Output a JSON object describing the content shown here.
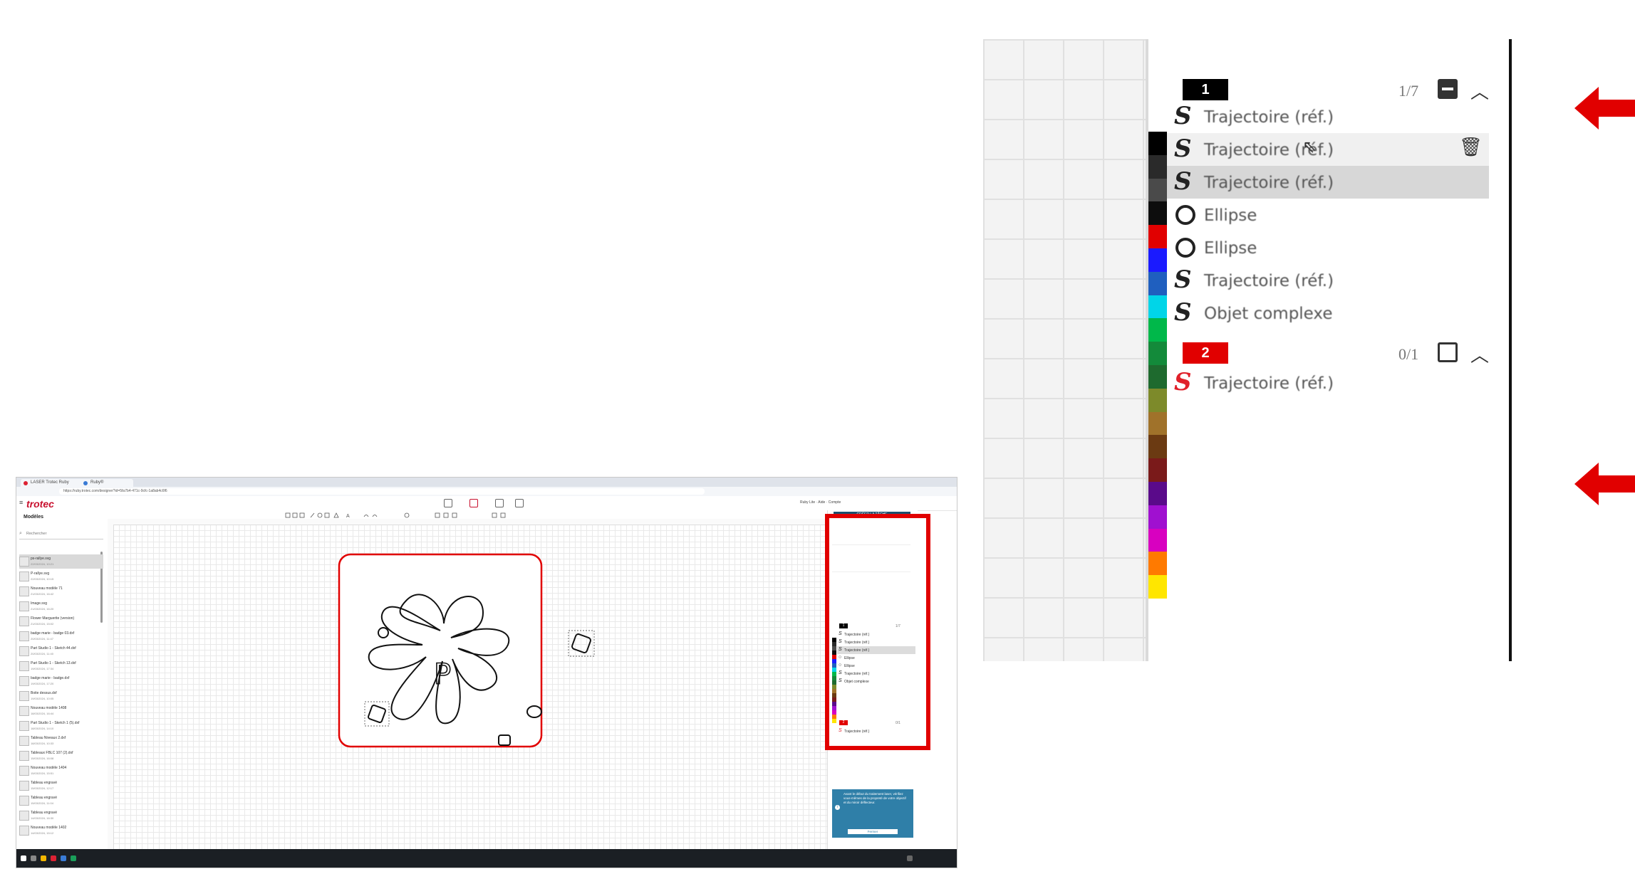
{
  "browser": {
    "tabs": [
      {
        "label": "LASER Trotec Ruby"
      },
      {
        "label": "Ruby®"
      }
    ],
    "url": "https://ruby.trotec.com/designer?id=5fa7b4-471c-9cfc-1a8ab4c6f6"
  },
  "app": {
    "logo": "trotec",
    "header_right": "Ruby Lite · Aide · Compte",
    "colors": {
      "brand": "#c8102e",
      "accent": "#1b4f6e",
      "notice": "#2f7fa8",
      "highlight": "#e10000"
    }
  },
  "sidebar": {
    "title": "Modèles",
    "search_placeholder": "Rechercher",
    "files": [
      {
        "name": "ps-rallye.svg",
        "date": "22/03/2024, 10:21"
      },
      {
        "name": "P-rallye.svg",
        "date": "22/03/2024, 10:15"
      },
      {
        "name": "Nouveau modèle 71",
        "date": "21/03/2024, 16:42"
      },
      {
        "name": "Image.svg",
        "date": "21/03/2024, 16:20"
      },
      {
        "name": "Flower Marguerite (version)",
        "date": "21/03/2024, 15:02"
      },
      {
        "name": "badge marie - badge 03.dxf",
        "date": "20/03/2024, 11:47"
      },
      {
        "name": "Part Studio 1 - Sketch 44.dxf",
        "date": "20/03/2024, 11:40"
      },
      {
        "name": "Part Studio 1 - Sketch 13.dxf",
        "date": "19/03/2024, 17:34"
      },
      {
        "name": "badge marie - badge.dxf",
        "date": "19/03/2024, 17:20"
      },
      {
        "name": "Boite dessus.dxf",
        "date": "19/03/2024, 10:05"
      },
      {
        "name": "Nouveau modèle 1408",
        "date": "18/03/2024, 16:44"
      },
      {
        "name": "Part Studio 1 - Sketch 1 (5).dxf",
        "date": "18/03/2024, 14:10"
      },
      {
        "name": "Tableau Niveaux 2.dxf",
        "date": "18/03/2024, 10:33"
      },
      {
        "name": "Tableaux FBLC 107 (2).dxf",
        "date": "15/03/2024, 16:08"
      },
      {
        "name": "Nouveau modèle 1404",
        "date": "15/03/2024, 15:51"
      },
      {
        "name": "Tableau engravé",
        "date": "15/03/2024, 12:17"
      },
      {
        "name": "Tableau engravé",
        "date": "15/03/2024, 11:04"
      },
      {
        "name": "Tableau engravé",
        "date": "14/03/2024, 16:30"
      },
      {
        "name": "Nouveau modèle 1402",
        "date": "14/03/2024, 15:12"
      }
    ]
  },
  "right_panel": {
    "button": "CRÉER LA TÂCHE",
    "notice": "Avant le début du traitement laser, vérifiez vous-mêmes de la propreté de votre objectif et du miroir déflecteur.",
    "notice_button": "Fermer"
  },
  "layers": [
    {
      "number": "1",
      "color": "#000000",
      "count": "1/7",
      "checked": true,
      "items": [
        {
          "icon": "path",
          "label": "Trajectoire (réf.)"
        },
        {
          "icon": "path",
          "label": "Trajectoire (réf.)",
          "hover": true
        },
        {
          "icon": "path",
          "label": "Trajectoire (réf.)",
          "selected": true
        },
        {
          "icon": "ellipse",
          "label": "Ellipse"
        },
        {
          "icon": "ellipse",
          "label": "Ellipse"
        },
        {
          "icon": "path",
          "label": "Trajectoire (réf.)"
        },
        {
          "icon": "path",
          "label": "Objet complexe"
        }
      ]
    },
    {
      "number": "2",
      "color": "#e10000",
      "count": "0/1",
      "checked": false,
      "items": [
        {
          "icon": "path",
          "label": "Trajectoire (réf.)"
        }
      ]
    }
  ],
  "palette": [
    "#000000",
    "#2a2a2a",
    "#4a4a4a",
    "#0d0d0d",
    "#e10000",
    "#1a1aff",
    "#1f5fbf",
    "#00d5e8",
    "#00b84a",
    "#138a3a",
    "#1e6a2e",
    "#7d8a2a",
    "#a0722a",
    "#6b3a12",
    "#7a1a1a",
    "#5a0a8a",
    "#a010d0",
    "#d800c0",
    "#ff7a00",
    "#ffe600"
  ],
  "tooltips": {
    "arrow_layer_1": "arrow",
    "arrow_layer_2": "arrow"
  }
}
